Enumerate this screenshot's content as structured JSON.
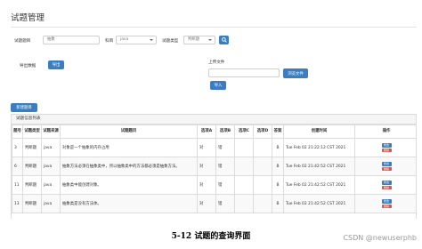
{
  "page": {
    "title": "试题管理"
  },
  "search": {
    "title_label": "试题题目",
    "title_value": "抽象",
    "subject_label": "科目",
    "subject_value": "java",
    "type_label": "试题类型",
    "type_value": "判断题",
    "search_icon": "search-icon"
  },
  "export": {
    "label": "导出数据",
    "button": "导出"
  },
  "upload": {
    "label": "上传文件",
    "browse_button": "浏览文件",
    "import_button": "导入"
  },
  "toolbar": {
    "new_button": "新建题目"
  },
  "table": {
    "panel_title": "试题信息列表",
    "columns": [
      "题号",
      "试题类型",
      "试题来源",
      "试题题目",
      "选项A",
      "选项B",
      "选项C",
      "选项D",
      "答案",
      "创建时间",
      "操作"
    ],
    "edit_label": "修改",
    "delete_label": "删除",
    "rows": [
      {
        "id": "3",
        "type": "判断题",
        "source": "java",
        "question": "对象是一个抽象的内存占用",
        "a": "对",
        "b": "错",
        "c": "",
        "d": "",
        "answer": "B",
        "created": "Tue Feb 02 21:22:12 CST 2021"
      },
      {
        "id": "6",
        "type": "判断题",
        "source": "java",
        "question": "抽象方法必须在抽象类中，所以抽象类中的方法都必须是抽象方法。",
        "a": "对",
        "b": "错",
        "c": "",
        "d": "",
        "answer": "B",
        "created": "Tue Feb 02 21:42:52 CST 2021"
      },
      {
        "id": "11",
        "type": "判断题",
        "source": "java",
        "question": "抽象类中能创建对象。",
        "a": "对",
        "b": "错",
        "c": "",
        "d": "",
        "answer": "B",
        "created": "Tue Feb 02 21:42:52 CST 2021"
      },
      {
        "id": "13",
        "type": "判断题",
        "source": "java",
        "question": "抽象类是没有方法体。",
        "a": "对",
        "b": "错",
        "c": "",
        "d": "",
        "answer": "B",
        "created": "Tue Feb 02 21:42:52 CST 2021"
      }
    ]
  },
  "caption": "5-12   试题的查询界面",
  "watermark": "CSDN @newuserphb"
}
